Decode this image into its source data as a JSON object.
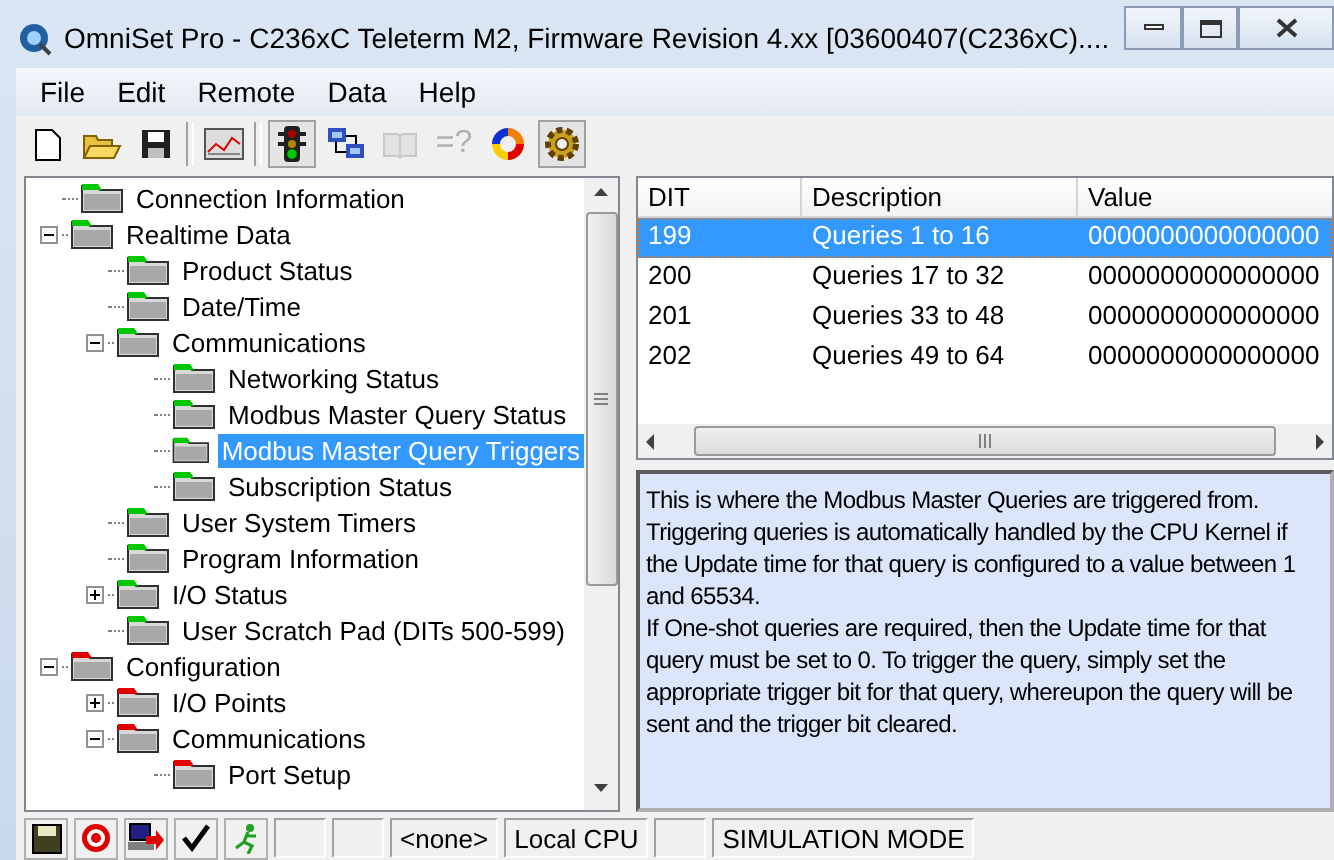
{
  "window": {
    "title": "OmniSet Pro - C236xC Teleterm M2, Firmware Revision 4.xx [03600407(C236xC)...."
  },
  "menu": [
    "File",
    "Edit",
    "Remote",
    "Data",
    "Help"
  ],
  "toolbar": [
    {
      "kind": "new",
      "disabled": false,
      "pressed": false
    },
    {
      "kind": "open",
      "disabled": false,
      "pressed": false
    },
    {
      "kind": "save",
      "disabled": false,
      "pressed": false
    },
    {
      "kind": "separator"
    },
    {
      "kind": "chart",
      "disabled": false,
      "pressed": false
    },
    {
      "kind": "separator"
    },
    {
      "kind": "traffic",
      "disabled": false,
      "pressed": true
    },
    {
      "kind": "network",
      "disabled": false,
      "pressed": false
    },
    {
      "kind": "book",
      "disabled": true,
      "pressed": false
    },
    {
      "kind": "text",
      "text": "=?",
      "disabled": true,
      "pressed": false
    },
    {
      "kind": "swirl",
      "disabled": false,
      "pressed": false
    },
    {
      "kind": "gear",
      "disabled": false,
      "pressed": true
    }
  ],
  "tree": [
    {
      "label": "Connection Information",
      "color": "#00c800",
      "selected": false
    },
    {
      "label": "Realtime Data",
      "color": "#00c800",
      "selected": false,
      "expanded": true,
      "children": [
        {
          "label": "Product Status",
          "color": "#00c800",
          "selected": false
        },
        {
          "label": "Date/Time",
          "color": "#00c800",
          "selected": false
        },
        {
          "label": "Communications",
          "color": "#00c800",
          "selected": false,
          "expanded": true,
          "children": [
            {
              "label": "Networking Status",
              "color": "#00c800",
              "selected": false
            },
            {
              "label": "Modbus Master Query Status",
              "color": "#00c800",
              "selected": false
            },
            {
              "label": "Modbus Master Query Triggers",
              "color": "#00c800",
              "selected": true
            },
            {
              "label": "Subscription Status",
              "color": "#00c800",
              "selected": false
            }
          ]
        },
        {
          "label": "User System Timers",
          "color": "#00c800",
          "selected": false
        },
        {
          "label": "Program Information",
          "color": "#00c800",
          "selected": false
        },
        {
          "label": "I/O Status",
          "color": "#00c800",
          "selected": false,
          "expanded": false
        },
        {
          "label": "User Scratch Pad (DITs 500-599)",
          "color": "#00c800",
          "selected": false
        }
      ]
    },
    {
      "label": "Configuration",
      "color": "#e00000",
      "selected": false,
      "expanded": true,
      "children": [
        {
          "label": "I/O Points",
          "color": "#e00000",
          "selected": false,
          "expanded": false
        },
        {
          "label": "Communications",
          "color": "#e00000",
          "selected": false,
          "expanded": true,
          "children": [
            {
              "label": "Port Setup",
              "color": "#e00000",
              "selected": false
            }
          ]
        }
      ]
    }
  ],
  "table": {
    "columns": [
      "DIT",
      "Description",
      "Value"
    ],
    "rows": [
      {
        "dit": "199",
        "description": "Queries 1 to 16",
        "value": "0000000000000000",
        "selected": true
      },
      {
        "dit": "200",
        "description": "Queries 17 to 32",
        "value": "0000000000000000",
        "selected": false
      },
      {
        "dit": "201",
        "description": "Queries 33 to 48",
        "value": "0000000000000000",
        "selected": false
      },
      {
        "dit": "202",
        "description": "Queries 49 to 64",
        "value": "0000000000000000",
        "selected": false
      }
    ]
  },
  "description": [
    "This is where the Modbus Master Queries are triggered from. Triggering queries is automatically handled by the CPU Kernel if the Update time for that query is configured to a value between 1 and 65534.",
    "If One-shot queries are required, then the Update time for that query must be set to 0. To trigger the query, simply set the appropriate trigger bit for that query, whereupon the query will be sent and the trigger bit cleared."
  ],
  "status_bar": [
    {
      "kind": "save"
    },
    {
      "kind": "target"
    },
    {
      "kind": "computer"
    },
    {
      "kind": "check"
    },
    {
      "kind": "runner"
    },
    {
      "kind": "pane"
    },
    {
      "kind": "pane"
    },
    {
      "kind": "pane",
      "text": "<none>"
    },
    {
      "kind": "pane",
      "text": "Local CPU"
    },
    {
      "kind": "pane"
    },
    {
      "kind": "pane",
      "text": "SIMULATION MODE"
    }
  ]
}
